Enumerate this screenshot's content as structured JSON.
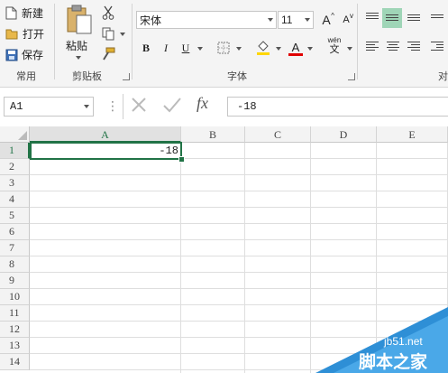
{
  "ribbon": {
    "clipboard": {
      "new_label": "新建",
      "open_label": "打开",
      "save_label": "保存",
      "paste_label": "粘贴",
      "group_label": "常用",
      "clipboard_group_label": "剪贴板"
    },
    "font": {
      "font_name": "宋体",
      "font_size": "11",
      "bold": "B",
      "italic": "I",
      "underline": "U",
      "font_color_letter": "A",
      "wen_label": "wén",
      "wen_char": "文",
      "grow_label": "A",
      "shrink_label": "A",
      "group_label": "字体"
    },
    "alignment": {
      "group_label_partial": "对"
    }
  },
  "formula_bar": {
    "name_box": "A1",
    "fx": "fx",
    "value": "-18"
  },
  "sheet": {
    "columns": [
      "A",
      "B",
      "C",
      "D",
      "E"
    ],
    "rows": [
      "1",
      "2",
      "3",
      "4",
      "5",
      "6",
      "7",
      "8",
      "9",
      "10",
      "11",
      "12",
      "13",
      "14"
    ],
    "cell_a1": "-18"
  },
  "watermark": {
    "url": "jb51.net",
    "site": "脚本之家"
  },
  "colors": {
    "select_green": "#217346",
    "font_color_red": "#e00000",
    "fill_yellow": "#ffd700"
  }
}
